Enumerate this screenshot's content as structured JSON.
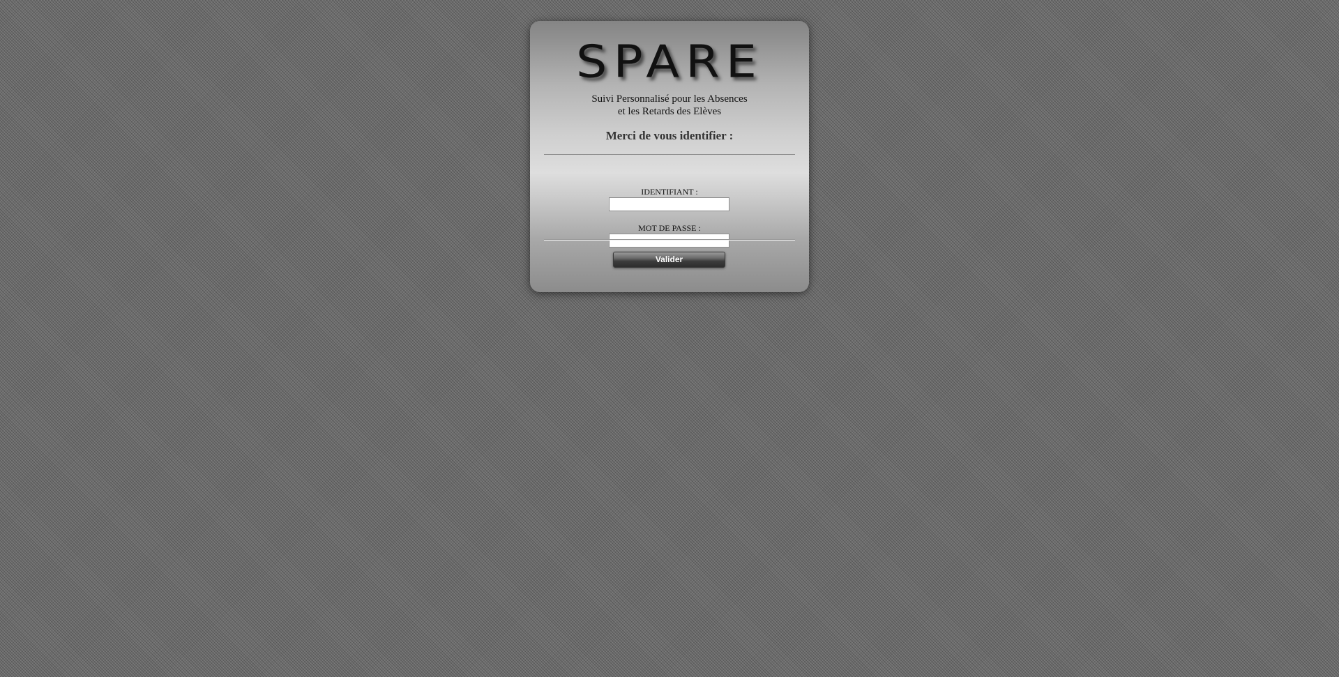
{
  "app": {
    "logo_text": "SPARE",
    "subtitle_line1": "Suivi Personnalisé pour les Absences",
    "subtitle_line2": "et les Retards des Elèves"
  },
  "login": {
    "prompt": "Merci de vous identifier :",
    "username": {
      "label": "IDENTIFIANT :",
      "value": "",
      "placeholder": ""
    },
    "password": {
      "label": "MOT DE PASSE :",
      "value": "",
      "placeholder": ""
    },
    "submit_label": "Valider"
  },
  "colors": {
    "page_background": "#6e6e6e",
    "card_highlight": "#dedede",
    "button_dark": "#2e2e2e",
    "button_text": "#ffffff"
  }
}
